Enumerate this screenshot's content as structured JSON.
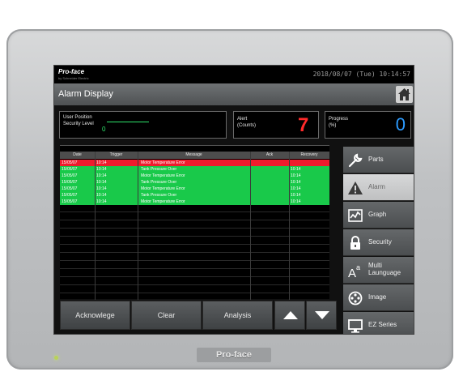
{
  "device": {
    "bezel_brand": "Pro-face"
  },
  "header": {
    "logo": "Pro-face",
    "logo_sub": "by Schneider Electric",
    "datetime": "2018/08/07 (Tue) 10:14:57"
  },
  "titlebar": {
    "title": "Alarm Display",
    "home_icon": "home-icon"
  },
  "info": {
    "user_position_label": "User Position",
    "security_level_label": "Security Level",
    "security_level_value": "0",
    "alert_label_1": "Alert",
    "alert_label_2": "(Counts)",
    "alert_value": "7",
    "progress_label_1": "Progress",
    "progress_label_2": "(%)",
    "progress_value": "0"
  },
  "table": {
    "headers": [
      "Date",
      "Trigger",
      "Message",
      "Ack",
      "Recovery"
    ],
    "rows": [
      {
        "date": "15/05/07",
        "trigger": "10:14",
        "message": "Motor Temperature Error",
        "ack": "",
        "recovery": "",
        "color": "#ef1b2d"
      },
      {
        "date": "15/05/07",
        "trigger": "10:14",
        "message": "Tank Pressure Over",
        "ack": "",
        "recovery": "10:14",
        "color": "#19c94a"
      },
      {
        "date": "15/05/07",
        "trigger": "10:14",
        "message": "Motor Temperature Error",
        "ack": "",
        "recovery": "10:14",
        "color": "#19c94a"
      },
      {
        "date": "15/05/07",
        "trigger": "10:14",
        "message": "Tank Pressure Over",
        "ack": "",
        "recovery": "10:14",
        "color": "#19c94a"
      },
      {
        "date": "15/05/07",
        "trigger": "10:14",
        "message": "Motor Temperature Error",
        "ack": "",
        "recovery": "10:14",
        "color": "#19c94a"
      },
      {
        "date": "15/05/07",
        "trigger": "10:14",
        "message": "Tank Pressure Over",
        "ack": "",
        "recovery": "10:14",
        "color": "#19c94a"
      },
      {
        "date": "15/05/07",
        "trigger": "10:14",
        "message": "Motor Temperature Error",
        "ack": "",
        "recovery": "10:14",
        "color": "#19c94a"
      }
    ]
  },
  "bottom_buttons": {
    "acknowledge": "Acknowlege",
    "clear": "Clear",
    "analysis": "Analysis",
    "up_icon": "up-arrow-icon",
    "down_icon": "down-arrow-icon"
  },
  "side_menu": {
    "items": [
      {
        "label": "Parts",
        "icon": "wrench-icon",
        "active": false
      },
      {
        "label": "Alarm",
        "icon": "warning-icon",
        "active": true
      },
      {
        "label": "Graph",
        "icon": "graph-icon",
        "active": false
      },
      {
        "label": "Security",
        "icon": "lock-icon",
        "active": false
      },
      {
        "label_1": "Multi",
        "label_2": "Launguage",
        "icon": "font-icon",
        "active": false
      },
      {
        "label": "Image",
        "icon": "film-reel-icon",
        "active": false
      },
      {
        "label": "EZ Series",
        "icon": "monitor-icon",
        "active": false
      }
    ]
  },
  "colors": {
    "accent_blue": "#2c9bff",
    "alert_red": "#ff2a2a",
    "level_green": "#2ee36b"
  }
}
